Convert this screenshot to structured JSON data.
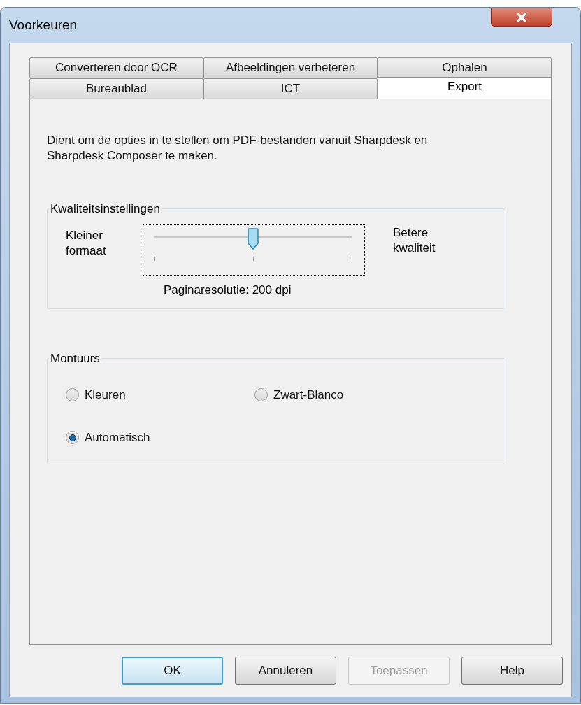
{
  "window": {
    "title": "Voorkeuren"
  },
  "tab_rows": [
    [
      {
        "label": "Converteren door OCR",
        "selected": false
      },
      {
        "label": "Afbeeldingen verbeteren",
        "selected": false
      },
      {
        "label": "Ophalen",
        "selected": false
      }
    ],
    [
      {
        "label": "Bureaublad",
        "selected": false
      },
      {
        "label": "ICT",
        "selected": false
      },
      {
        "label": "Export",
        "selected": true
      }
    ]
  ],
  "description": "Dient om de opties in te stellen om PDF-bestanden vanuit Sharpdesk en Sharpdesk Composer te maken.",
  "quality": {
    "title": "Kwaliteitsinstellingen",
    "left_label": "Kleiner formaat",
    "right_label": "Betere kwaliteit",
    "level": 0.5,
    "reading": "Paginaresolutie: 200 dpi"
  },
  "color_mode": {
    "title": "Montuurs",
    "options": [
      {
        "label": "Kleuren",
        "selected": false
      },
      {
        "label": "Zwart-Blanco",
        "selected": false
      },
      {
        "label": "Automatisch",
        "selected": true
      }
    ]
  },
  "buttons": [
    {
      "label": "OK",
      "kind": "default",
      "disabled": false
    },
    {
      "label": "Annuleren",
      "kind": "normal",
      "disabled": false
    },
    {
      "label": "Toepassen",
      "kind": "normal",
      "disabled": true
    },
    {
      "label": "Help",
      "kind": "normal",
      "disabled": false
    }
  ]
}
